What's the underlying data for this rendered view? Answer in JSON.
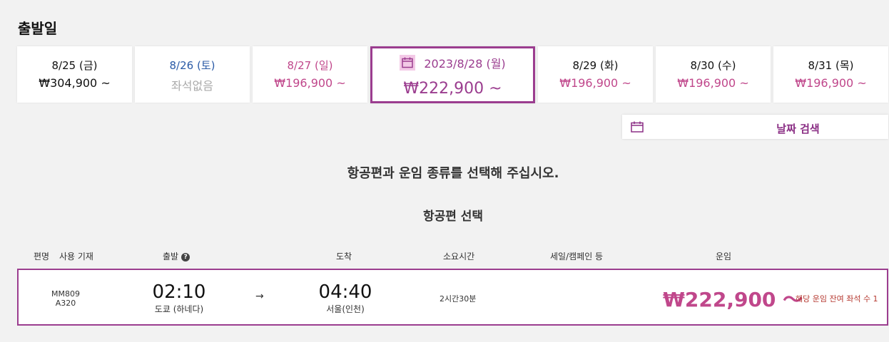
{
  "section_title": "출발일",
  "dates": [
    {
      "date": "8/25 (금)",
      "price": "₩304,900 ~"
    },
    {
      "date": "8/26 (토)",
      "price": "좌석없음"
    },
    {
      "date": "8/27 (일)",
      "price": "₩196,900 ~"
    },
    {
      "date": "2023/8/28 (월)",
      "price": "₩222,900 ~"
    },
    {
      "date": "8/29 (화)",
      "price": "₩196,900 ~"
    },
    {
      "date": "8/30 (수)",
      "price": "₩196,900 ~"
    },
    {
      "date": "8/31 (목)",
      "price": "₩196,900 ~"
    }
  ],
  "date_search_label": "날짜 검색",
  "instruction": "항공편과 운임 종류를 선택해 주십시오.",
  "flight_select_title": "항공편 선택",
  "columns": {
    "flight_no": "편명",
    "aircraft": "사용 기재",
    "departure": "출발",
    "arrival": "도착",
    "duration": "소요시간",
    "sale": "세일/캠페인 등",
    "fare": "운임"
  },
  "flight": {
    "flight_no": "MM809",
    "aircraft": "A320",
    "dep_time": "02:10",
    "dep_place": "도쿄 (하네다)",
    "arrow": "→",
    "arr_time": "04:40",
    "arr_place": "서울(인천)",
    "duration": "2시간30분",
    "fare": "₩222,900 ～",
    "remaining": "해당 운임 잔여 좌석 수 1"
  },
  "colors": {
    "accent": "#9b3d8f",
    "price_pink": "#c0478b",
    "weekend_blue": "#2a5aa6",
    "remaining_red": "#b5382f"
  },
  "icons": {
    "calendar": "calendar-icon",
    "help": "help-icon"
  }
}
